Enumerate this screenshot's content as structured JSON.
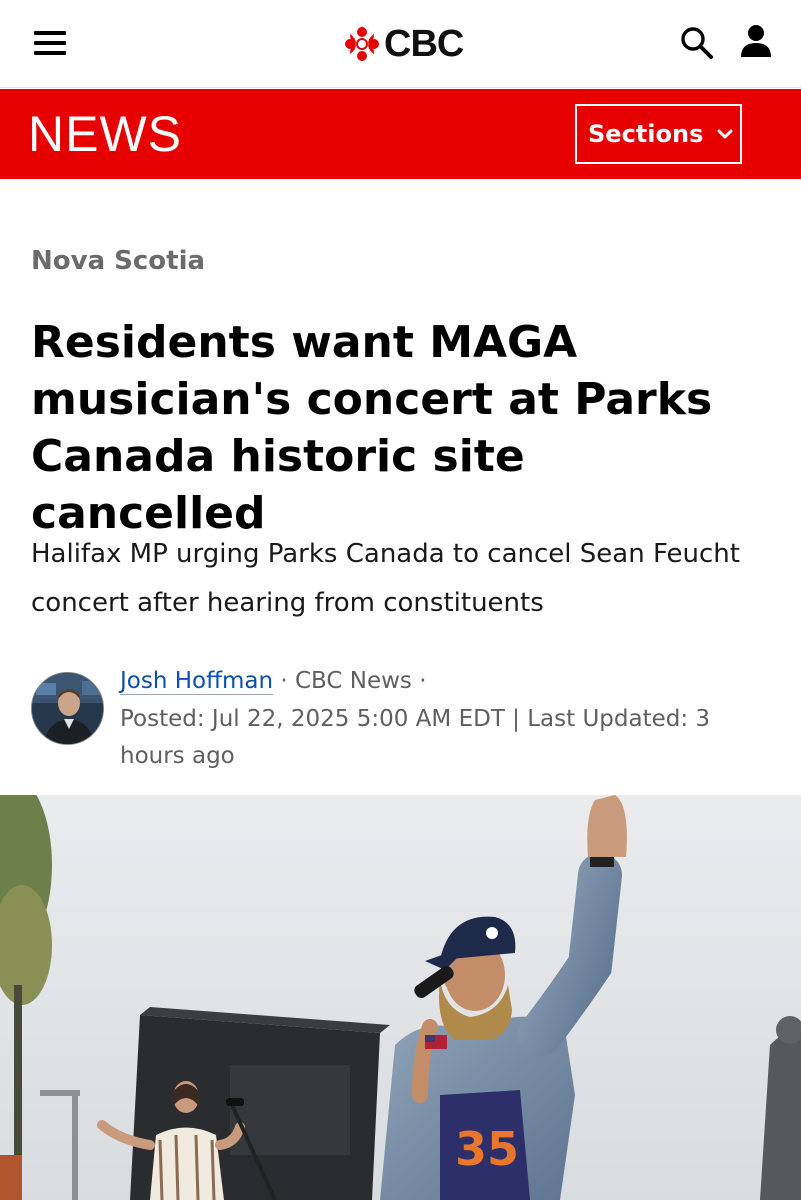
{
  "header": {
    "logo_text": "CBC",
    "menu_icon": "hamburger-menu-icon",
    "search_icon": "search-icon",
    "account_icon": "account-icon"
  },
  "newsbar": {
    "title": "NEWS",
    "sections_label": "Sections",
    "color": "#e60000"
  },
  "article": {
    "category": "Nova Scotia",
    "headline": "Residents want MAGA musician's concert at Parks Canada historic site cancelled",
    "deck": "Halifax MP urging Parks Canada to cancel Sean Feucht concert after hearing from constituents",
    "author": "Josh Hoffman",
    "source": "· CBC News ·",
    "posted": "Posted: Jul 22, 2025 5:00 AM EDT | Last Updated: 3 hours ago"
  }
}
